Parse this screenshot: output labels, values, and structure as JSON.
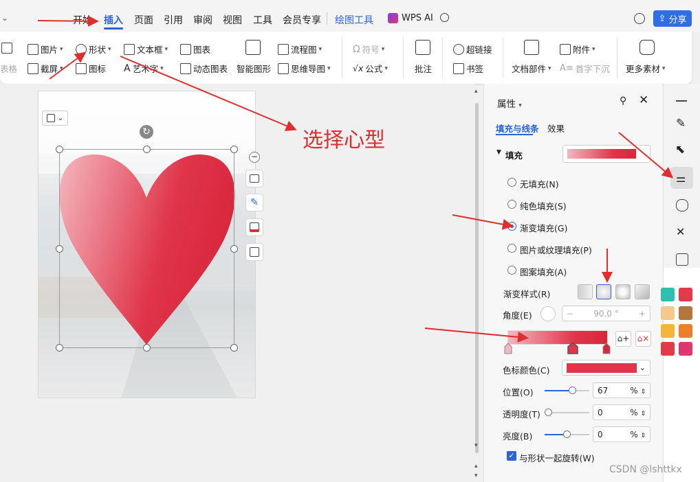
{
  "tabs": [
    "开始",
    "插入",
    "页面",
    "引用",
    "审阅",
    "视图",
    "工具",
    "会员专享",
    "绘图工具",
    "WPS AI"
  ],
  "share_label": "分享",
  "ribbon": {
    "picture": "图片",
    "shape": "形状",
    "textbox": "文本框",
    "chart": "图表",
    "flowchart": "流程图",
    "symbol": "符号",
    "comment": "批注",
    "hyperlink": "超链接",
    "attachment": "附件",
    "table_partial": "表格",
    "screenshot": "截屏",
    "icon": "图标",
    "wordart": "艺术字",
    "dynamic_chart": "动态图表",
    "smart_graphic": "智能图形",
    "mindmap": "思维导图",
    "formula": "公式",
    "bookmark": "书签",
    "doc_parts": "文档部件",
    "dropcap": "首字下沉",
    "more_assets": "更多素材"
  },
  "annotation": "选择心型",
  "panel": {
    "title": "属性",
    "tab_fill_line": "填充与线条",
    "tab_effects": "效果",
    "fill_section": "填充",
    "fill_color": "#e0354a",
    "options": [
      "无填充(N)",
      "纯色填充(S)",
      "渐变填充(G)",
      "图片或纹理填充(P)",
      "图案填充(A)"
    ],
    "selected_option": "渐变填充(G)",
    "gradient_style_label": "渐变样式(R)",
    "angle_label": "角度(E)",
    "angle_value": "90.0",
    "angle_unit": "°",
    "stop_color_label": "色标颜色(C)",
    "stop_color": "#e0354a",
    "position_label": "位置(O)",
    "position_value": "67",
    "transparency_label": "透明度(T)",
    "transparency_value": "0",
    "brightness_label": "亮度(B)",
    "brightness_value": "0",
    "percent": "%",
    "rotate_with_shape": "与形状一起旋转(W)",
    "rotate_checked": true
  },
  "swatches": [
    "#2ebfb0",
    "#e33a4a",
    "#f5c98b",
    "#b5763e",
    "#f4b53a",
    "#ef7e2c",
    "#e33a4a",
    "#e0356f"
  ],
  "watermark": "CSDN @lshttkx"
}
